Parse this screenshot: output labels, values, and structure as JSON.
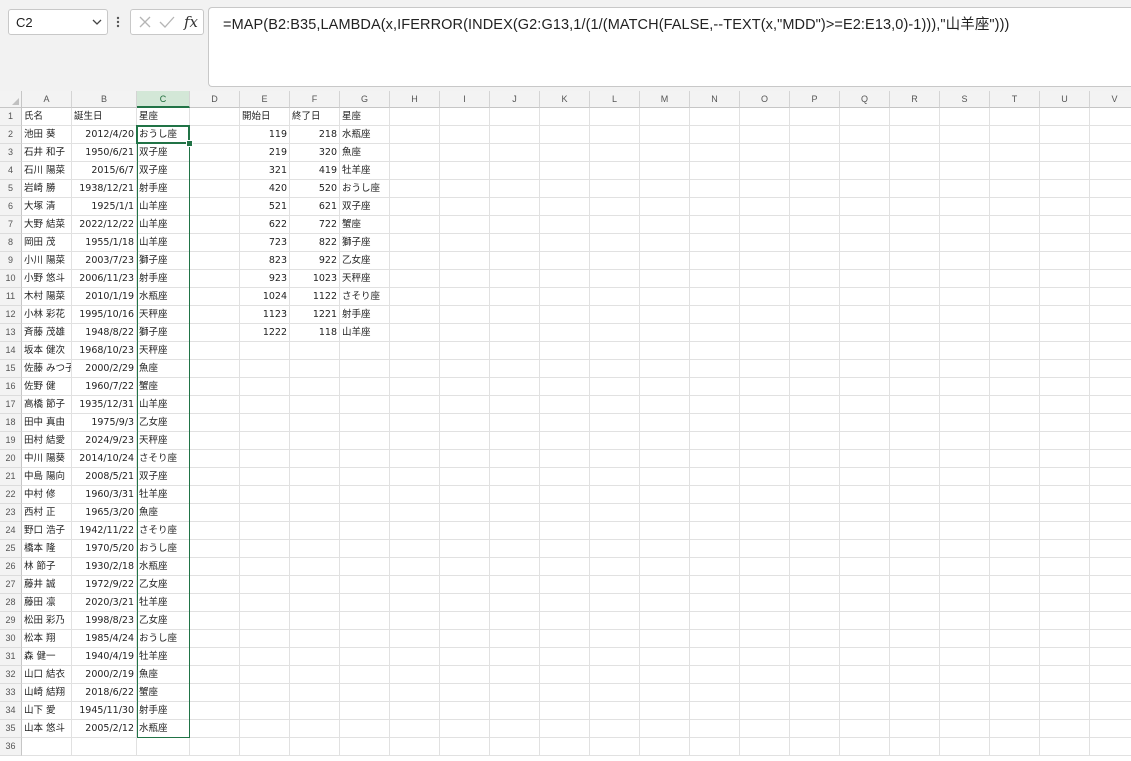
{
  "name_box": {
    "value": "C2"
  },
  "formula_bar": {
    "formula": "=MAP(B2:B35,LAMBDA(x,IFERROR(INDEX(G2:G13,1/(1/(MATCH(FALSE,--TEXT(x,\"MDD\")>=E2:E13,0)-1))),\"山羊座\")))"
  },
  "sheet": {
    "columns": [
      "A",
      "B",
      "C",
      "D",
      "E",
      "F",
      "G",
      "H",
      "I",
      "J",
      "K",
      "L",
      "M",
      "N",
      "O",
      "P",
      "Q",
      "R",
      "S",
      "T",
      "U",
      "V"
    ],
    "selected_column": "C",
    "row_count": 36,
    "headers": {
      "name": "氏名",
      "birthday": "誕生日",
      "sign": "星座",
      "start": "開始日",
      "end": "終了日",
      "sign2": "星座"
    },
    "people": [
      {
        "name": "池田 葵",
        "birthday": "2012/4/20",
        "sign": "おうし座"
      },
      {
        "name": "石井 和子",
        "birthday": "1950/6/21",
        "sign": "双子座"
      },
      {
        "name": "石川 陽菜",
        "birthday": "2015/6/7",
        "sign": "双子座"
      },
      {
        "name": "岩崎 勝",
        "birthday": "1938/12/21",
        "sign": "射手座"
      },
      {
        "name": "大塚 清",
        "birthday": "1925/1/1",
        "sign": "山羊座"
      },
      {
        "name": "大野 結菜",
        "birthday": "2022/12/22",
        "sign": "山羊座"
      },
      {
        "name": "岡田 茂",
        "birthday": "1955/1/18",
        "sign": "山羊座"
      },
      {
        "name": "小川 陽菜",
        "birthday": "2003/7/23",
        "sign": "獅子座"
      },
      {
        "name": "小野 悠斗",
        "birthday": "2006/11/23",
        "sign": "射手座"
      },
      {
        "name": "木村 陽菜",
        "birthday": "2010/1/19",
        "sign": "水瓶座"
      },
      {
        "name": "小林 彩花",
        "birthday": "1995/10/16",
        "sign": "天秤座"
      },
      {
        "name": "斉藤 茂雄",
        "birthday": "1948/8/22",
        "sign": "獅子座"
      },
      {
        "name": "坂本 健次",
        "birthday": "1968/10/23",
        "sign": "天秤座"
      },
      {
        "name": "佐藤 みつ子",
        "birthday": "2000/2/29",
        "sign": "魚座"
      },
      {
        "name": "佐野 健",
        "birthday": "1960/7/22",
        "sign": "蟹座"
      },
      {
        "name": "高橋 節子",
        "birthday": "1935/12/31",
        "sign": "山羊座"
      },
      {
        "name": "田中 真由",
        "birthday": "1975/9/3",
        "sign": "乙女座"
      },
      {
        "name": "田村 結愛",
        "birthday": "2024/9/23",
        "sign": "天秤座"
      },
      {
        "name": "中川 陽葵",
        "birthday": "2014/10/24",
        "sign": "さそり座"
      },
      {
        "name": "中島 陽向",
        "birthday": "2008/5/21",
        "sign": "双子座"
      },
      {
        "name": "中村 修",
        "birthday": "1960/3/31",
        "sign": "牡羊座"
      },
      {
        "name": "西村 正",
        "birthday": "1965/3/20",
        "sign": "魚座"
      },
      {
        "name": "野口 浩子",
        "birthday": "1942/11/22",
        "sign": "さそり座"
      },
      {
        "name": "橋本 隆",
        "birthday": "1970/5/20",
        "sign": "おうし座"
      },
      {
        "name": "林 節子",
        "birthday": "1930/2/18",
        "sign": "水瓶座"
      },
      {
        "name": "藤井 誠",
        "birthday": "1972/9/22",
        "sign": "乙女座"
      },
      {
        "name": "藤田 凛",
        "birthday": "2020/3/21",
        "sign": "牡羊座"
      },
      {
        "name": "松田 彩乃",
        "birthday": "1998/8/23",
        "sign": "乙女座"
      },
      {
        "name": "松本 翔",
        "birthday": "1985/4/24",
        "sign": "おうし座"
      },
      {
        "name": "森 健一",
        "birthday": "1940/4/19",
        "sign": "牡羊座"
      },
      {
        "name": "山口 結衣",
        "birthday": "2000/2/19",
        "sign": "魚座"
      },
      {
        "name": "山崎 結翔",
        "birthday": "2018/6/22",
        "sign": "蟹座"
      },
      {
        "name": "山下 愛",
        "birthday": "1945/11/30",
        "sign": "射手座"
      },
      {
        "name": "山本 悠斗",
        "birthday": "2005/2/12",
        "sign": "水瓶座"
      }
    ],
    "zodiac_table": [
      {
        "start": "119",
        "end": "218",
        "sign": "水瓶座"
      },
      {
        "start": "219",
        "end": "320",
        "sign": "魚座"
      },
      {
        "start": "321",
        "end": "419",
        "sign": "牡羊座"
      },
      {
        "start": "420",
        "end": "520",
        "sign": "おうし座"
      },
      {
        "start": "521",
        "end": "621",
        "sign": "双子座"
      },
      {
        "start": "622",
        "end": "722",
        "sign": "蟹座"
      },
      {
        "start": "723",
        "end": "822",
        "sign": "獅子座"
      },
      {
        "start": "823",
        "end": "922",
        "sign": "乙女座"
      },
      {
        "start": "923",
        "end": "1023",
        "sign": "天秤座"
      },
      {
        "start": "1024",
        "end": "1122",
        "sign": "さそり座"
      },
      {
        "start": "1123",
        "end": "1221",
        "sign": "射手座"
      },
      {
        "start": "1222",
        "end": "118",
        "sign": "山羊座"
      }
    ]
  }
}
